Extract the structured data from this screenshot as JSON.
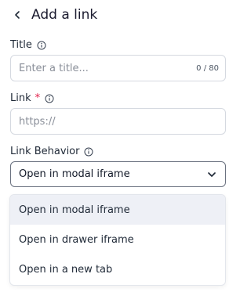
{
  "header": {
    "title": "Add a link",
    "back_icon": "chevron-left-icon"
  },
  "title_field": {
    "label": "Title",
    "placeholder": "Enter a title...",
    "value": "",
    "counter": "0 / 80"
  },
  "link_field": {
    "label": "Link",
    "required_mark": "*",
    "placeholder": "https://",
    "value": ""
  },
  "behavior_field": {
    "label": "Link Behavior",
    "selected": "Open in modal iframe",
    "options": [
      "Open in modal iframe",
      "Open in drawer iframe",
      "Open in a new tab"
    ]
  },
  "colors": {
    "required": "#e11d48",
    "selected_option_bg": "#eef0f6",
    "border": "#d5d9e0"
  }
}
